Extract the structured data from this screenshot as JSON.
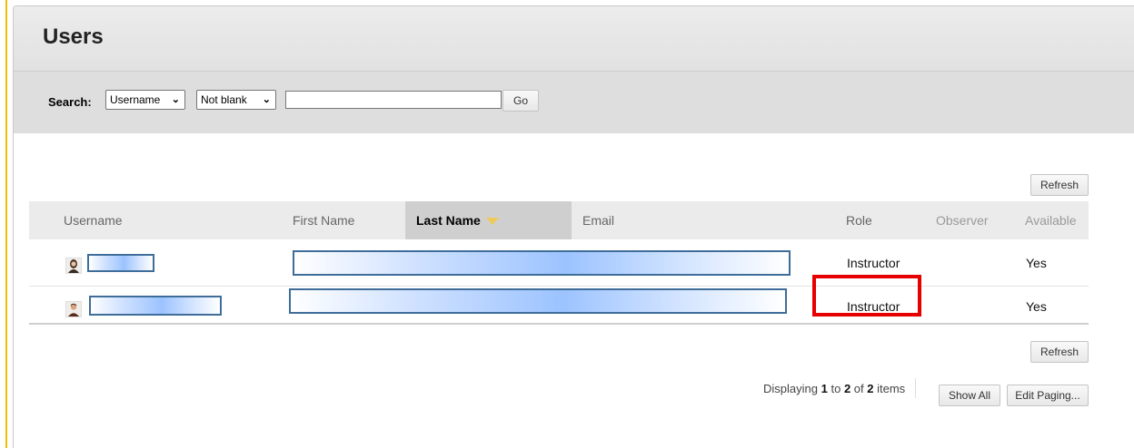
{
  "page_title": "Users",
  "search": {
    "label": "Search:",
    "field_selected": "Username",
    "operator_selected": "Not blank",
    "value": "",
    "go_label": "Go"
  },
  "toolbar": {
    "refresh_label": "Refresh"
  },
  "table": {
    "columns": {
      "username": "Username",
      "first_name": "First Name",
      "last_name": "Last Name",
      "email": "Email",
      "role": "Role",
      "observer": "Observer",
      "available": "Available"
    },
    "sorted_by": "Last Name",
    "rows": [
      {
        "avatar": "female-avatar-icon",
        "username": "",
        "first_name": "",
        "last_name": "",
        "email": "",
        "role": "Instructor",
        "observer": "",
        "available": "Yes"
      },
      {
        "avatar": "male-avatar-icon",
        "username": "",
        "first_name": "",
        "last_name": "",
        "email": "",
        "role": "Instructor",
        "observer": "",
        "available": "Yes"
      }
    ]
  },
  "paging": {
    "prefix": "Displaying",
    "from": "1",
    "to_word": "to",
    "to": "2",
    "of_word": "of",
    "total": "2",
    "suffix": "items",
    "show_all_label": "Show All",
    "edit_paging_label": "Edit Paging..."
  },
  "colors": {
    "highlight": "#e60000",
    "accent_rule": "#f2c200",
    "sort_arrow": "#f0c95a",
    "redaction_border": "#3f6d99"
  }
}
